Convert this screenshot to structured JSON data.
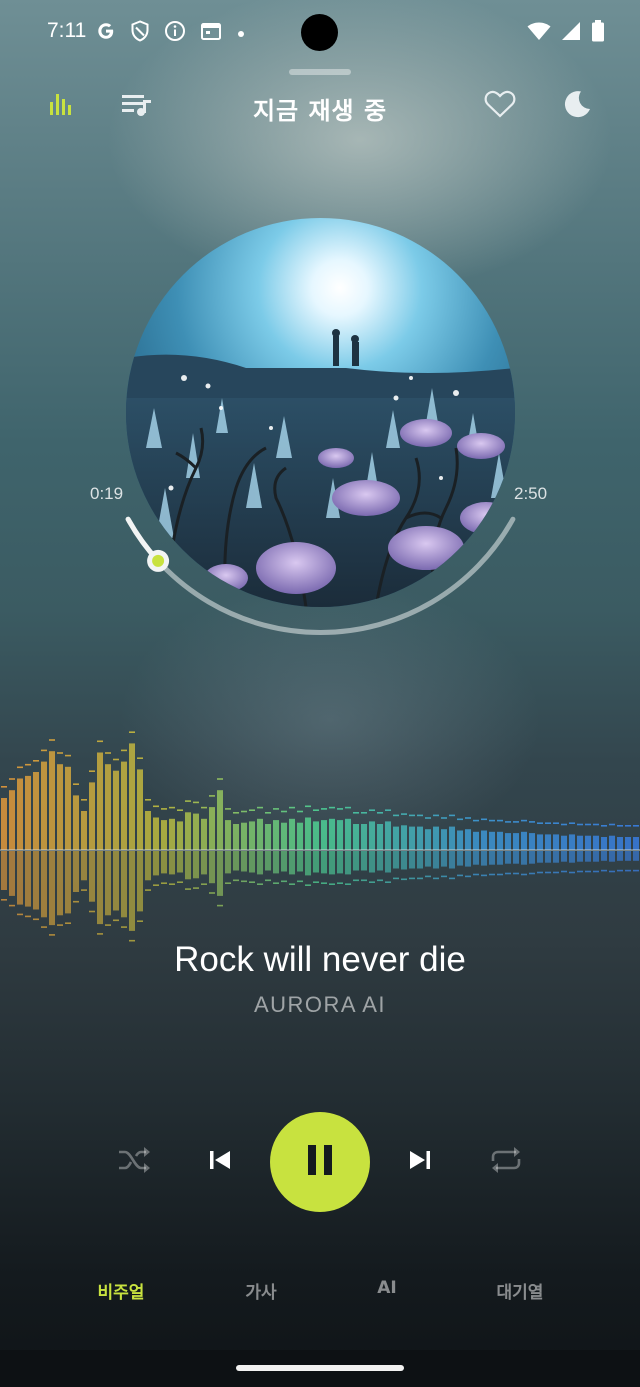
{
  "status": {
    "time": "7:11",
    "left_icons": [
      "google-g-icon",
      "shield-icon",
      "info-icon",
      "calendar-icon",
      "dot-icon"
    ],
    "right_icons": [
      "wifi-icon",
      "signal-icon",
      "battery-icon"
    ]
  },
  "header": {
    "title": "지금 재생 중",
    "equalizer_icon_color": "#c8e23f"
  },
  "player": {
    "elapsed": "0:19",
    "duration": "2:50",
    "progress": 0.11,
    "track_title": "Rock will never die",
    "artist": "AURORA AI",
    "is_playing": true,
    "accent_color": "#c8e23f"
  },
  "tabs": [
    {
      "label": "비주얼",
      "active": true
    },
    {
      "label": "가사",
      "active": false
    },
    {
      "label": "AI",
      "active": false
    },
    {
      "label": "대기열",
      "active": false
    }
  ],
  "visualizer": {
    "levels": [
      0.4,
      0.46,
      0.55,
      0.57,
      0.6,
      0.68,
      0.76,
      0.66,
      0.64,
      0.42,
      0.3,
      0.52,
      0.75,
      0.66,
      0.61,
      0.68,
      0.82,
      0.62,
      0.3,
      0.25,
      0.23,
      0.24,
      0.22,
      0.29,
      0.28,
      0.24,
      0.33,
      0.46,
      0.23,
      0.2,
      0.21,
      0.22,
      0.24,
      0.2,
      0.23,
      0.21,
      0.24,
      0.21,
      0.25,
      0.22,
      0.23,
      0.24,
      0.23,
      0.24,
      0.2,
      0.2,
      0.22,
      0.2,
      0.22,
      0.18,
      0.19,
      0.18,
      0.18,
      0.16,
      0.18,
      0.16,
      0.18,
      0.15,
      0.16,
      0.14,
      0.15,
      0.14,
      0.14,
      0.13,
      0.13,
      0.14,
      0.13,
      0.12,
      0.12,
      0.12,
      0.11,
      0.12,
      0.11,
      0.11,
      0.11,
      0.1,
      0.11,
      0.1,
      0.1,
      0.1
    ],
    "colors": [
      "#f0a03a",
      "#c9c63e",
      "#4fdc9a",
      "#3f9fe0",
      "#3a82ec"
    ]
  }
}
